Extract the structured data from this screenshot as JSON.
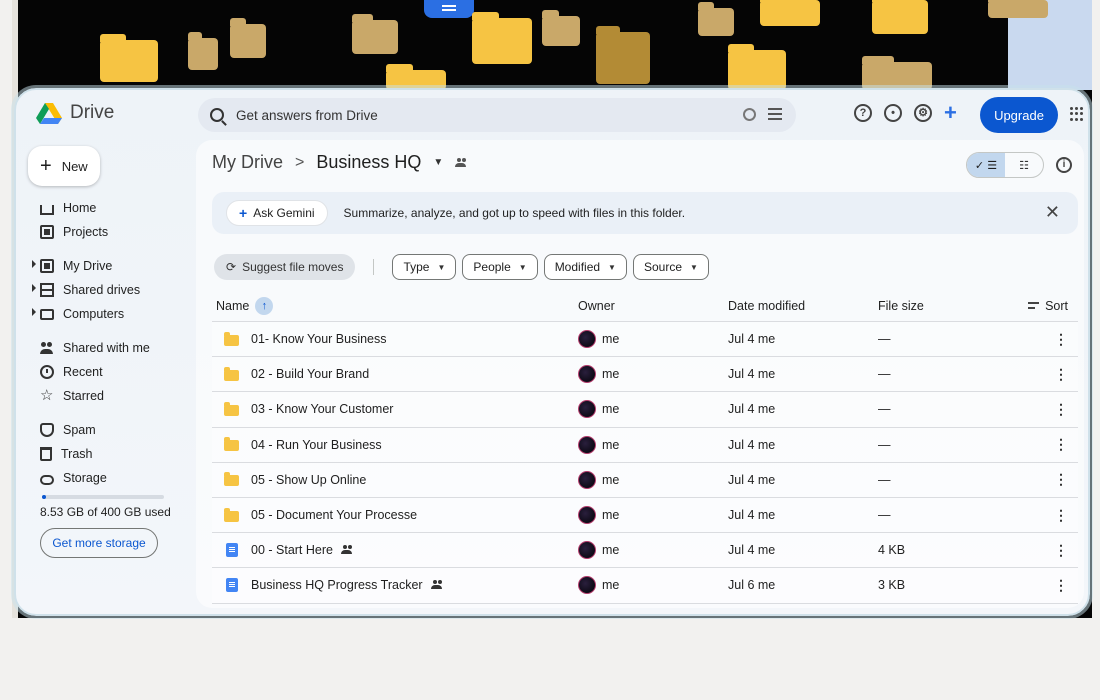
{
  "app": {
    "name": "Drive"
  },
  "search": {
    "placeholder": "Get answers from Drive"
  },
  "topbar": {
    "upgrade_label": "Upgrade"
  },
  "sidebar": {
    "new_label": "New",
    "items": [
      {
        "label": "Home",
        "icon": "home-icon"
      },
      {
        "label": "Projects",
        "icon": "projects-icon"
      },
      {
        "label": "My Drive",
        "icon": "my-drive-icon"
      },
      {
        "label": "Shared drives",
        "icon": "shared-drives-icon"
      },
      {
        "label": "Computers",
        "icon": "computers-icon"
      },
      {
        "label": "Shared with me",
        "icon": "shared-with-me-icon"
      },
      {
        "label": "Recent",
        "icon": "clock-icon"
      },
      {
        "label": "Starred",
        "icon": "star-icon"
      },
      {
        "label": "Spam",
        "icon": "spam-icon"
      },
      {
        "label": "Trash",
        "icon": "trash-icon"
      },
      {
        "label": "Storage",
        "icon": "cloud-icon"
      }
    ],
    "storage": {
      "used_text": "8.53 GB of 400 GB used",
      "used_fraction": 0.021,
      "button_label": "Get more storage"
    }
  },
  "breadcrumb": {
    "root": "My Drive",
    "separator": ">",
    "current": "Business HQ"
  },
  "view_toggle": {
    "list_label": "✓ ☰",
    "grid_label": "☷"
  },
  "gemini": {
    "button_label": "Ask Gemini",
    "text": "Summarize, analyze, and got up to speed with files in this folder.",
    "close": "✕"
  },
  "filters": {
    "suggest_label": "Suggest file moves",
    "chips": [
      "Type",
      "People",
      "Modified",
      "Source"
    ]
  },
  "table": {
    "headers": {
      "name": "Name",
      "owner": "Owner",
      "date": "Date modified",
      "size": "File size",
      "sort": "Sort"
    },
    "rows": [
      {
        "name": "01- Know Your Business",
        "type": "folder",
        "owner": "me",
        "date": "Jul 4 me",
        "size": "—",
        "shared": false
      },
      {
        "name": "02 - Build Your Brand",
        "type": "folder",
        "owner": "me",
        "date": "Jul 4 me",
        "size": "—",
        "shared": false
      },
      {
        "name": "03 - Know Your Customer",
        "type": "folder",
        "owner": "me",
        "date": "Jul 4 me",
        "size": "—",
        "shared": false
      },
      {
        "name": "04 - Run Your Business",
        "type": "folder",
        "owner": "me",
        "date": "Jul 4 me",
        "size": "—",
        "shared": false
      },
      {
        "name": "05 - Show Up Online",
        "type": "folder",
        "owner": "me",
        "date": "Jul 4 me",
        "size": "—",
        "shared": false
      },
      {
        "name": "05 - Document Your Processe",
        "type": "folder",
        "owner": "me",
        "date": "Jul 4 me",
        "size": "—",
        "shared": false
      },
      {
        "name": "00 - Start Here",
        "type": "doc",
        "owner": "me",
        "date": "Jul 4 me",
        "size": "4 KB",
        "shared": true
      },
      {
        "name": "Business HQ Progress Tracker",
        "type": "doc",
        "owner": "me",
        "date": "Jul 6 me",
        "size": "3 KB",
        "shared": true
      }
    ]
  },
  "colors": {
    "accent": "#0b57d0",
    "folder": "#f6c443",
    "doc": "#4285f4"
  }
}
